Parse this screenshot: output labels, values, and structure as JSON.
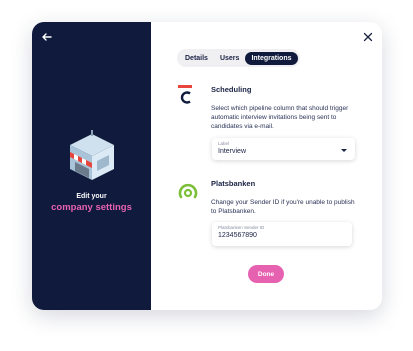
{
  "left_panel": {
    "line1": "Edit your",
    "line2": "company settings"
  },
  "tabs": [
    {
      "label": "Details"
    },
    {
      "label": "Users"
    },
    {
      "label": "Integrations"
    }
  ],
  "scheduling": {
    "title": "Scheduling",
    "description": "Select which pipeline column that should trigger automatic interview invitations being sent to candidates via e-mail.",
    "field_label": "Label",
    "field_value": "Interview"
  },
  "platsbanken": {
    "title": "Platsbanken",
    "description": "Change your Sender ID if you're unable to publish to Platsbanken.",
    "field_label": "Platsbanken Sender ID",
    "field_value": "1234567890"
  },
  "done_label": "Done",
  "colors": {
    "navy": "#0f1a3c",
    "pink": "#e661b0",
    "red": "#e8453c",
    "green": "#7bbf3a"
  }
}
